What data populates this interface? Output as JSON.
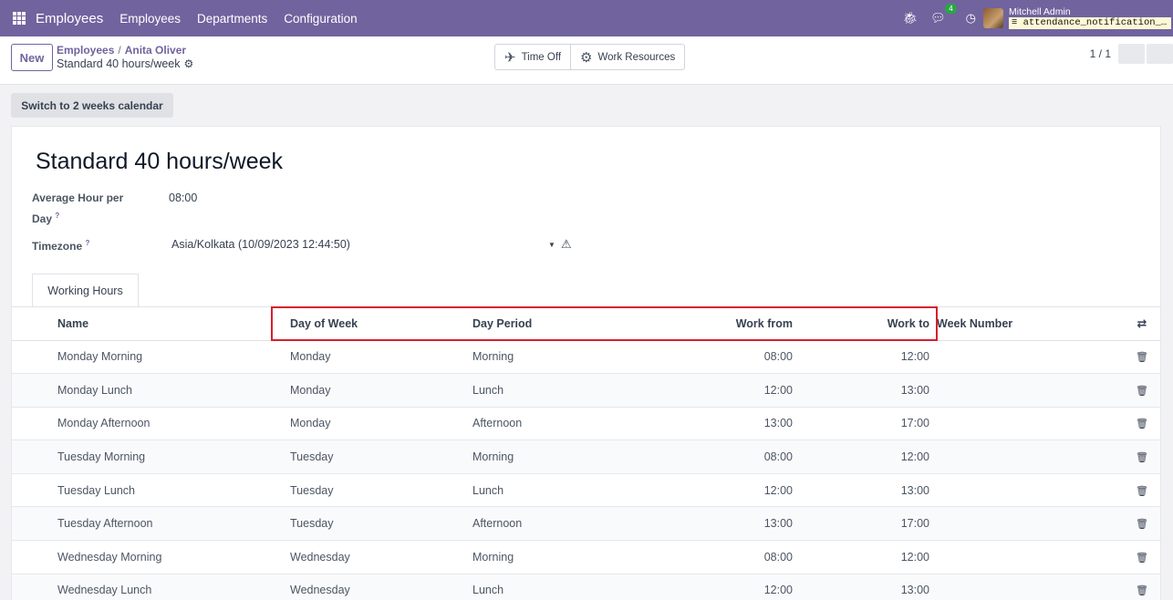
{
  "navbar": {
    "app_name": "Employees",
    "menus": [
      "Employees",
      "Departments",
      "Configuration"
    ],
    "chat_count": "4",
    "user_name": "Mitchell Admin",
    "database": "attendance_notification_…",
    "icons": [
      "apps-grid-icon",
      "bug-icon",
      "chat-icon",
      "clock-icon",
      "database-icon"
    ]
  },
  "control": {
    "new_label": "New",
    "breadcrumb": [
      "Employees",
      "Anita Oliver"
    ],
    "current": "Standard 40 hours/week",
    "smart_buttons": [
      "Time Off",
      "Work Resources"
    ],
    "pager": "1 / 1"
  },
  "header": {
    "switch_label": "Switch to 2 weeks calendar"
  },
  "form": {
    "title": "Standard 40 hours/week",
    "avg_label_1": "Average Hour per",
    "avg_label_2": "Day",
    "avg_value": "08:00",
    "tz_label": "Timezone",
    "tz_value": "Asia/Kolkata (10/09/2023 12:44:50)",
    "help_mark": "?"
  },
  "tabs": [
    "Working Hours"
  ],
  "table": {
    "headers": [
      "Name",
      "Day of Week",
      "Day Period",
      "Work from",
      "Work to",
      "Week Number"
    ],
    "rows": [
      [
        "Monday Morning",
        "Monday",
        "Morning",
        "08:00",
        "12:00"
      ],
      [
        "Monday Lunch",
        "Monday",
        "Lunch",
        "12:00",
        "13:00"
      ],
      [
        "Monday Afternoon",
        "Monday",
        "Afternoon",
        "13:00",
        "17:00"
      ],
      [
        "Tuesday Morning",
        "Tuesday",
        "Morning",
        "08:00",
        "12:00"
      ],
      [
        "Tuesday Lunch",
        "Tuesday",
        "Lunch",
        "12:00",
        "13:00"
      ],
      [
        "Tuesday Afternoon",
        "Tuesday",
        "Afternoon",
        "13:00",
        "17:00"
      ],
      [
        "Wednesday Morning",
        "Wednesday",
        "Morning",
        "08:00",
        "12:00"
      ],
      [
        "Wednesday Lunch",
        "Wednesday",
        "Lunch",
        "12:00",
        "13:00"
      ]
    ]
  },
  "colors": {
    "brand": "#71639e",
    "highlight": "#d81e2c",
    "db_tag": "#fff8d5"
  }
}
